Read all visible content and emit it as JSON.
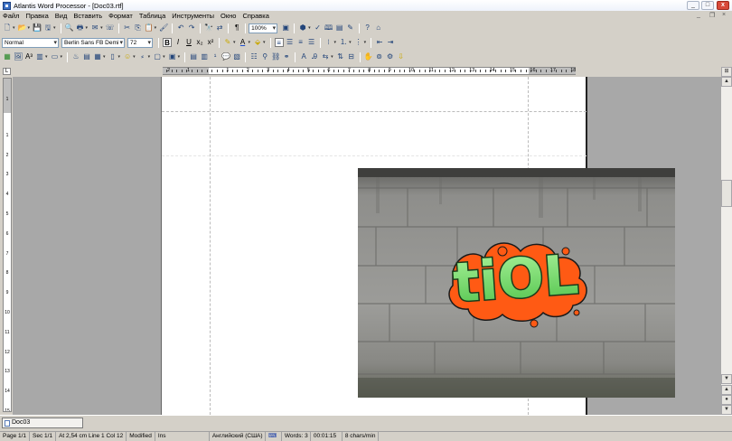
{
  "window": {
    "title": "Atlantis Word Processor - [Doc03.rtf]",
    "minimize": "_",
    "maximize": "□",
    "close": "x"
  },
  "menu": [
    "Файл",
    "Правка",
    "Вид",
    "Вставить",
    "Формат",
    "Таблица",
    "Инструменты",
    "Окно",
    "Справка"
  ],
  "format_bar": {
    "style": "Normal",
    "font": "Berlin Sans FB Demi",
    "size": "72",
    "zoom": "100%",
    "bold": "B",
    "italic": "I",
    "underline": "U"
  },
  "ruler": {
    "numbers": [
      "2",
      "1",
      "1",
      "2",
      "3",
      "4",
      "5",
      "6",
      "7",
      "8",
      "9",
      "10",
      "11",
      "12",
      "13",
      "14",
      "15",
      "16",
      "17",
      "18"
    ],
    "vertical_numbers": [
      "1",
      "1",
      "2",
      "3",
      "4",
      "5",
      "6",
      "7",
      "8",
      "9",
      "10",
      "11",
      "12",
      "13",
      "14",
      "15"
    ]
  },
  "document": {
    "image_text": "tiOL",
    "colors": {
      "wall": "#8d8d8a",
      "graffiti_green": "#7fe07a",
      "graffiti_orange": "#ff5a14"
    }
  },
  "tabs": [
    {
      "label": "Doc03"
    }
  ],
  "status": {
    "page": "Page 1/1",
    "sec": "Sec 1/1",
    "pos": "At 2,54 cm  Line 1  Col 12",
    "modified": "Modified",
    "ins": "Ins",
    "language": "Английский (США)",
    "words": "Words: 3",
    "time": "00:01:15",
    "speed": "8 chars/min"
  }
}
